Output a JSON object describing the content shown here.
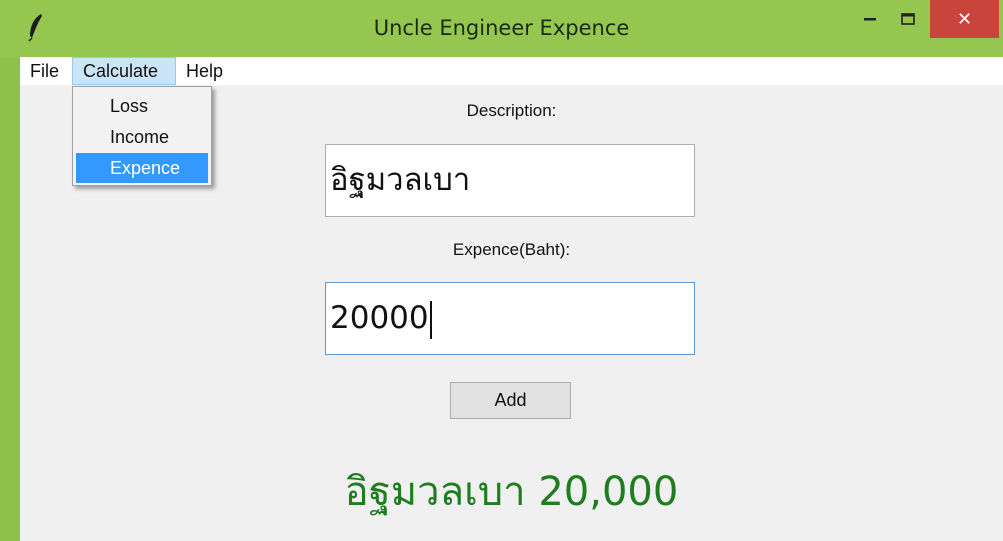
{
  "window": {
    "title": "Uncle Engineer Expence",
    "icon": "feather-icon",
    "controls": {
      "minimize": "minimize-icon",
      "maximize": "maximize-icon",
      "close_glyph": "✕"
    }
  },
  "menubar": {
    "items": [
      {
        "label": "File"
      },
      {
        "label": "Calculate"
      },
      {
        "label": "Help"
      }
    ],
    "open_menu": "Calculate"
  },
  "dropdown": {
    "items": [
      {
        "label": "Loss"
      },
      {
        "label": "Income"
      },
      {
        "label": "Expence",
        "selected": true
      }
    ]
  },
  "form": {
    "description_label": "Description:",
    "description_value": "อิฐมวลเบา",
    "expence_label": "Expence(Baht):",
    "expence_value": "20000",
    "add_button": "Add"
  },
  "result": {
    "text": "อิฐมวลเบา 20,000",
    "color": "#1f7d1f"
  },
  "colors": {
    "titlebar": "#95c64f",
    "close_button": "#c9443b",
    "menu_highlight": "#3399ff"
  }
}
